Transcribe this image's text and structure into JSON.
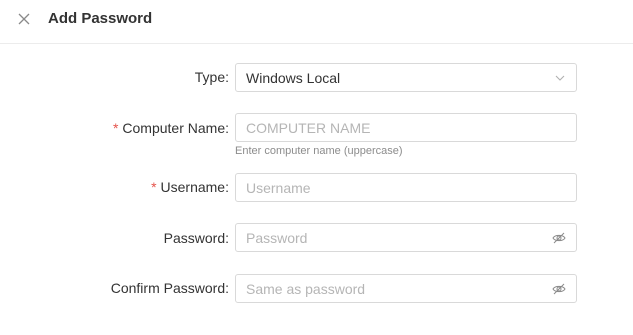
{
  "header": {
    "title": "Add Password",
    "close_icon": "close-icon"
  },
  "form": {
    "type": {
      "label": "Type",
      "required": false,
      "value": "Windows Local",
      "icon": "chevron-down-icon"
    },
    "computer_name": {
      "label": "Computer Name",
      "required": true,
      "placeholder": "COMPUTER NAME",
      "value": "",
      "help": "Enter computer name (uppercase)"
    },
    "username": {
      "label": "Username",
      "required": true,
      "placeholder": "Username",
      "value": ""
    },
    "password": {
      "label": "Password",
      "required": false,
      "placeholder": "Password",
      "value": "",
      "icon": "eye-slash-icon"
    },
    "confirm_password": {
      "label": "Confirm Password",
      "required": false,
      "placeholder": "Same as password",
      "value": "",
      "icon": "eye-slash-icon"
    },
    "colon": ":",
    "required_mark": "*"
  },
  "colors": {
    "required": "#e5534b",
    "border": "#d9d9d9",
    "placeholder": "#b5b5b5",
    "help_text": "#8c8c8c"
  }
}
